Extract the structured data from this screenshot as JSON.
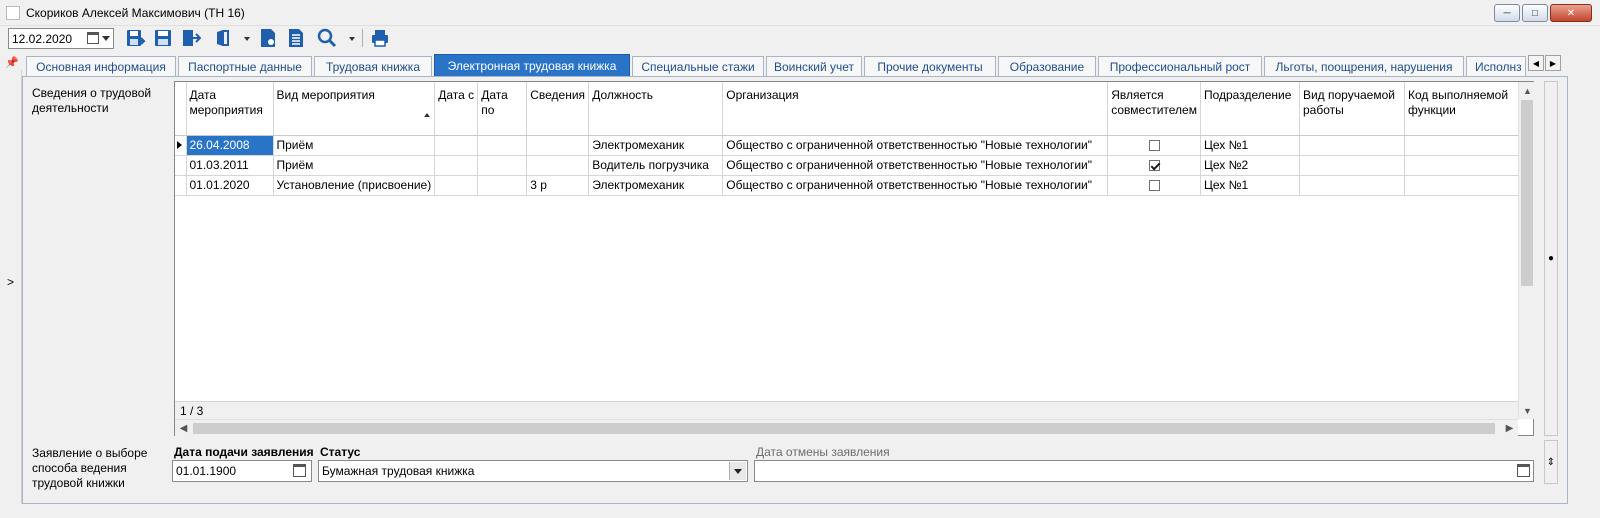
{
  "window": {
    "title": "Скориков Алексей Максимович (ТН 16)"
  },
  "toolbar": {
    "date": "12.02.2020",
    "icons": [
      "save-as-icon",
      "save-icon",
      "exit-icon",
      "document-icon",
      "report-icon",
      "list-icon",
      "search-icon",
      "print-icon"
    ]
  },
  "tabs": [
    {
      "label": "Основная информация"
    },
    {
      "label": "Паспортные данные"
    },
    {
      "label": "Трудовая книжка"
    },
    {
      "label": "Электронная трудовая книжка",
      "active": true
    },
    {
      "label": "Специальные стажи"
    },
    {
      "label": "Воинский учет"
    },
    {
      "label": "Прочие документы"
    },
    {
      "label": "Образование"
    },
    {
      "label": "Профессиональный рост"
    },
    {
      "label": "Льготы, поощрения, нарушения"
    },
    {
      "label": "Исполнз"
    }
  ],
  "work_section": {
    "label": "Сведения о трудовой деятельности",
    "columns": [
      {
        "label": "Дата мероприятия"
      },
      {
        "label": "Вид мероприятия"
      },
      {
        "label": "Дата с"
      },
      {
        "label": "Дата по"
      },
      {
        "label": "Сведения"
      },
      {
        "label": "Должность"
      },
      {
        "label": "Организация"
      },
      {
        "label": "Является совместителем"
      },
      {
        "label": "Подразделение"
      },
      {
        "label": "Вид поручаемой работы"
      },
      {
        "label": "Код выполняемой функции"
      }
    ],
    "rows": [
      {
        "date": "26.04.2008",
        "event": "Приём",
        "date_from": "",
        "date_to": "",
        "info": "",
        "position": "Электромеханик",
        "org": "Общество с ограниченной ответственностью \"Новые технологии\"",
        "part_time": false,
        "dept": "Цех №1",
        "work_type": "",
        "func_code": "",
        "selected": true
      },
      {
        "date": "01.03.2011",
        "event": "Приём",
        "date_from": "",
        "date_to": "",
        "info": "",
        "position": "Водитель погрузчика",
        "org": "Общество с ограниченной ответственностью \"Новые технологии\"",
        "part_time": true,
        "dept": "Цех №2",
        "work_type": "",
        "func_code": ""
      },
      {
        "date": "01.01.2020",
        "event": "Установление (присвоение)",
        "date_from": "",
        "date_to": "",
        "info": "3 р",
        "position": "Электромеханик",
        "org": "Общество с ограниченной ответственностью \"Новые технологии\"",
        "part_time": false,
        "dept": "Цех №1",
        "work_type": "",
        "func_code": ""
      }
    ],
    "record_counter": "1 / 3"
  },
  "application": {
    "label": "Заявление о выборе способа ведения трудовой книжки",
    "submit_date_label": "Дата подачи заявления",
    "submit_date": "01.01.1900",
    "status_label": "Статус",
    "status": "Бумажная трудовая книжка",
    "cancel_date_label": "Дата отмены заявления",
    "cancel_date": ""
  }
}
